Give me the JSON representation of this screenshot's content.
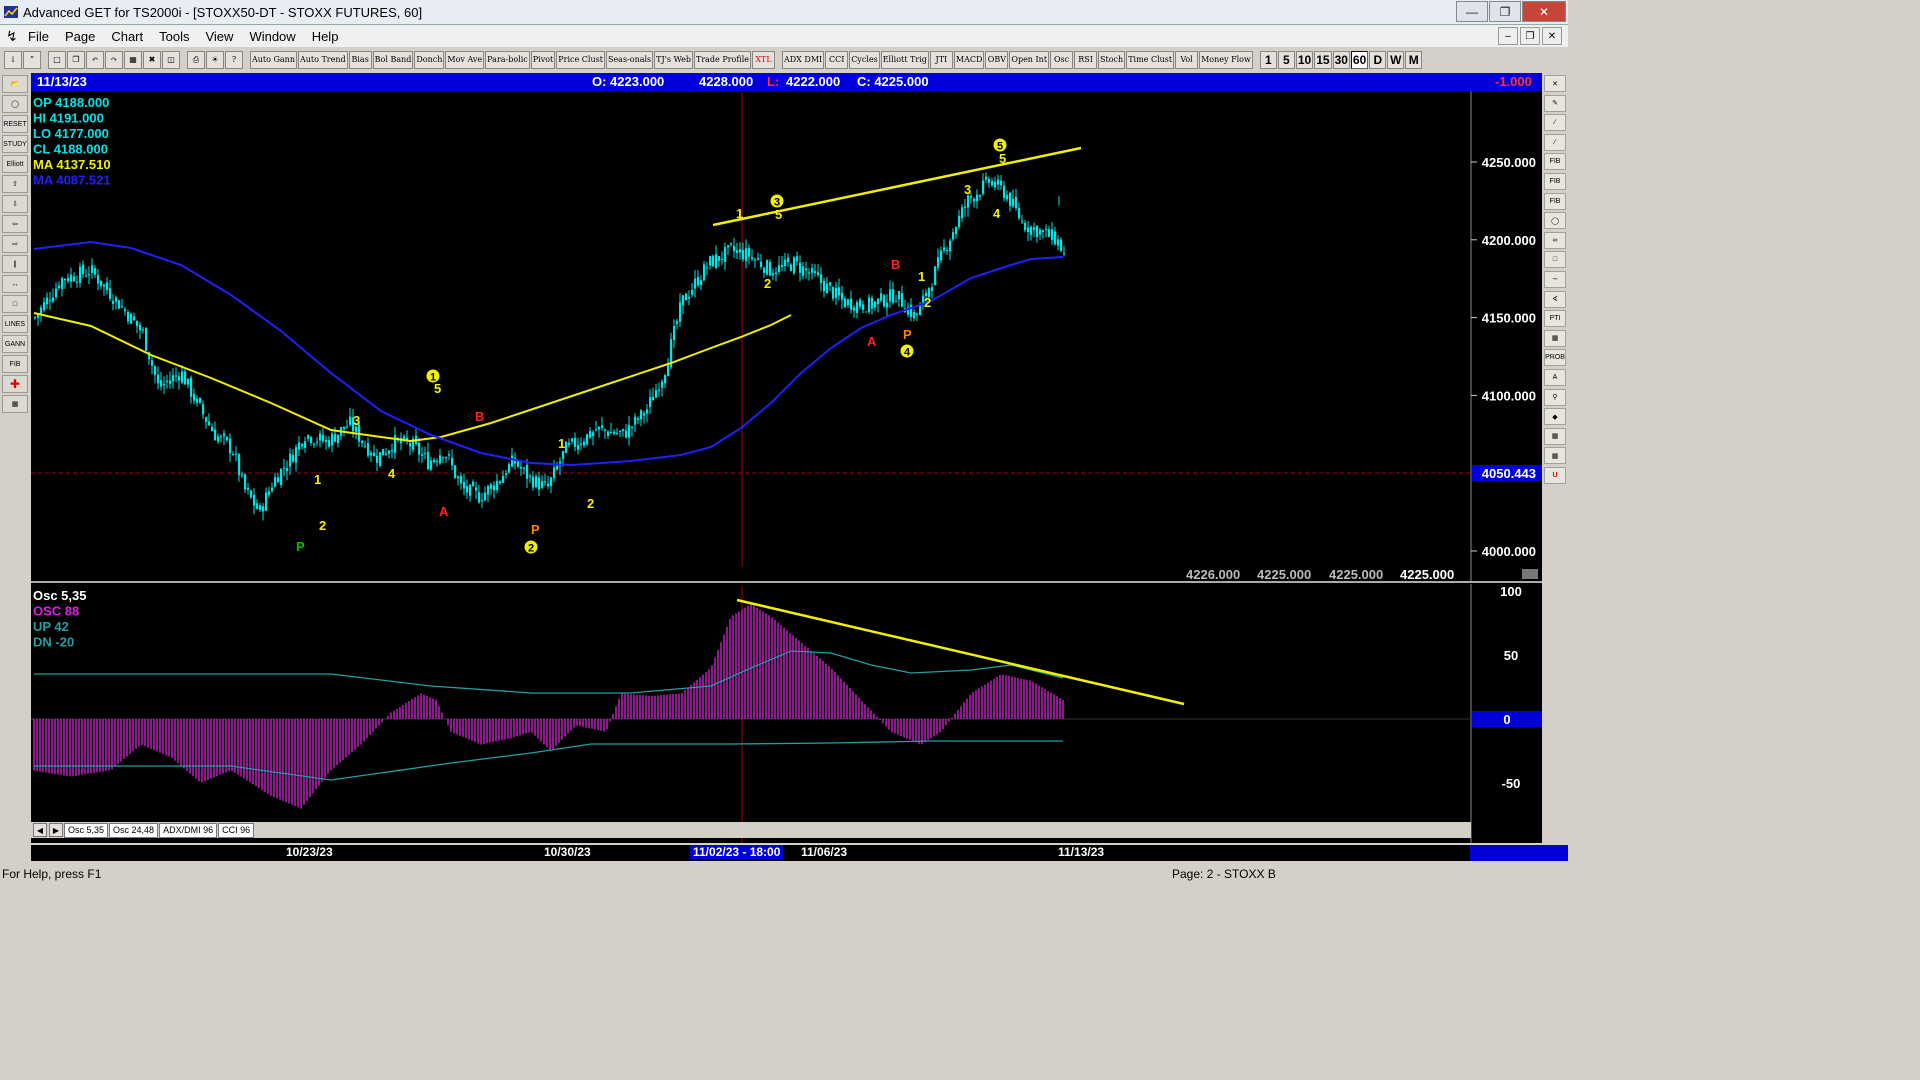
{
  "window": {
    "title": "Advanced GET for TS2000i - [STOXX50-DT - STOXX FUTURES, 60]"
  },
  "menu": [
    "File",
    "Page",
    "Chart",
    "Tools",
    "View",
    "Window",
    "Help"
  ],
  "toolbar": {
    "studies": [
      "Auto Gann",
      "Auto Trend",
      "Bias",
      "Bol Band",
      "Donch",
      "Mov Ave",
      "Para-bolic",
      "Pivot",
      "Price Clust",
      "Seas-onals",
      "TJ's Web",
      "Trade Profile",
      "XTL",
      "ADX DMI",
      "CCI",
      "Cycles",
      "Elliott Trig",
      "JTI",
      "MACD",
      "OBV",
      "Open Int",
      "Osc",
      "RSI",
      "Stoch",
      "Time Clust",
      "Vol",
      "Money Flow"
    ],
    "periods": [
      "1",
      "5",
      "10",
      "15",
      "30",
      "60",
      "D",
      "W",
      "M"
    ],
    "selected_period": "60"
  },
  "info_bar": {
    "date": "11/13/23",
    "open": "O: 4223.000",
    "high": "4228.000",
    "low_label": "L:",
    "low": "4222.000",
    "close": "C: 4225.000",
    "change": "-1.000"
  },
  "price_legend": [
    {
      "label": "OP",
      "value": "4188.000",
      "color": "#00e5e5"
    },
    {
      "label": "HI",
      "value": "4191.000",
      "color": "#00e5e5"
    },
    {
      "label": "LO",
      "value": "4177.000",
      "color": "#00e5e5"
    },
    {
      "label": "CL",
      "value": "4188.000",
      "color": "#00e5e5"
    },
    {
      "label": "MA",
      "value": "4137.510",
      "color": "#f0f000"
    },
    {
      "label": "MA",
      "value": "4087.521",
      "color": "#2020ff"
    }
  ],
  "price_axis": {
    "ticks": [
      "4250.000",
      "4200.000",
      "4150.000",
      "4100.000",
      "4000.000"
    ],
    "marker": "4050.443"
  },
  "bottom_values": [
    "4226.000",
    "4225.000",
    "4225.000",
    "4225.000"
  ],
  "osc_legend": [
    {
      "label": "Osc 5,35",
      "color": "#ffffff"
    },
    {
      "label": "OSC 88",
      "color": "#e020e0"
    },
    {
      "label": "UP   42",
      "color": "#20a0a0"
    },
    {
      "label": "DN   -20",
      "color": "#20a0a0"
    }
  ],
  "osc_axis": {
    "ticks": [
      "100",
      "50",
      "-50"
    ],
    "zero": "0"
  },
  "tabs": [
    "Osc 5,35",
    "Osc 24,48",
    "ADX/DMI 96",
    "CCI 96"
  ],
  "dates": {
    "d1": "10/23/23",
    "d2": "10/30/23",
    "cursor": "11/02/23 - 18:00",
    "d3": "11/06/23",
    "d4": "11/13/23"
  },
  "wave_labels": [
    "P",
    "1",
    "2",
    "3",
    "4",
    "5",
    "1",
    "A",
    "B",
    "2",
    "P",
    "1",
    "2",
    "3",
    "4",
    "5",
    "A",
    "B",
    "1",
    "2",
    "4",
    "P",
    "3",
    "4",
    "5"
  ],
  "status": {
    "help": "For Help, press F1",
    "page": "Page: 2 - STOXX B"
  },
  "chart_data": {
    "type": "candlestick",
    "price_range": [
      3990,
      4275
    ],
    "moving_average_1_color": "#f0f000",
    "moving_average_2_color": "#2020ff",
    "oscillator_range": [
      -80,
      100
    ]
  }
}
